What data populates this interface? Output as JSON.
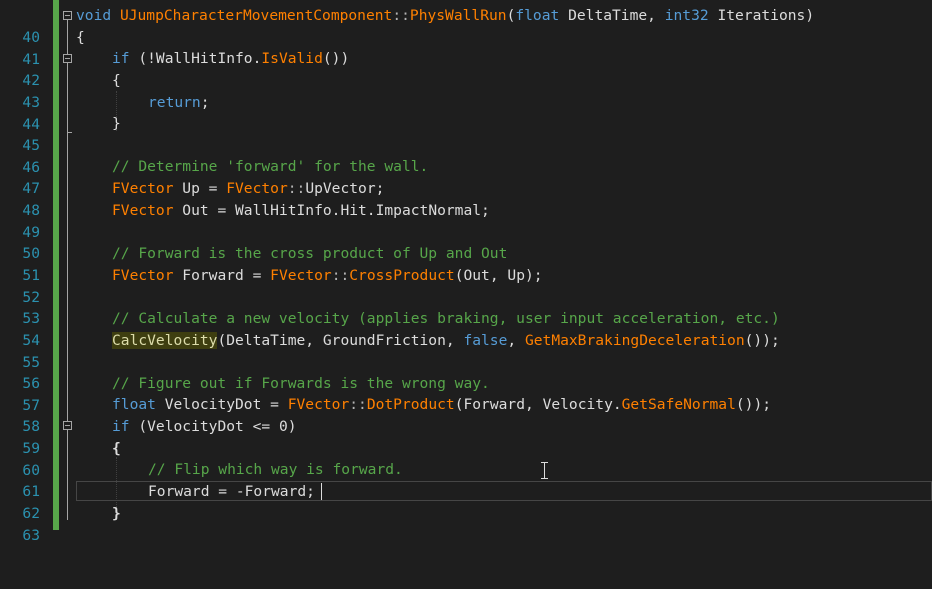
{
  "editor": {
    "colors": {
      "background": "#1e1e1e",
      "line_number": "#2b91af",
      "keyword": "#569cd6",
      "type": "#4ec9b0",
      "function": "#ff8000",
      "comment": "#57a64a",
      "change_bar": "#57a64a"
    },
    "line_numbers": [
      "40",
      "41",
      "42",
      "43",
      "44",
      "45",
      "46",
      "47",
      "48",
      "49",
      "50",
      "51",
      "52",
      "53",
      "54",
      "55",
      "56",
      "57",
      "58",
      "59",
      "60",
      "61",
      "62",
      "63"
    ],
    "tokens": {
      "l40": [
        "void",
        " ",
        "UJumpCharacterMovementComponent",
        "::",
        "PhysWallRun",
        "(",
        "float",
        " DeltaTime, ",
        "int32",
        " Iterations)"
      ],
      "l41": [
        "{"
      ],
      "l42": [
        "if",
        " (!WallHitInfo.",
        "IsValid",
        "())"
      ],
      "l43": [
        "{"
      ],
      "l44": [
        "return",
        ";"
      ],
      "l45": [
        "}"
      ],
      "l47": [
        "// Determine 'forward' for the wall."
      ],
      "l48": [
        "FVector",
        " Up = ",
        "FVector",
        "::",
        "UpVector;"
      ],
      "l49": [
        "FVector",
        " Out = WallHitInfo.Hit.ImpactNormal;"
      ],
      "l51": [
        "// Forward is the cross product of Up and Out"
      ],
      "l52": [
        "FVector",
        " Forward = ",
        "FVector",
        "::",
        "CrossProduct",
        "(Out, Up);"
      ],
      "l54": [
        "// Calculate a new velocity (applies braking, user input acceleration, etc.)"
      ],
      "l55": [
        "CalcVelocity",
        "(DeltaTime, GroundFriction, ",
        "false",
        ", ",
        "GetMaxBrakingDeceleration",
        "());"
      ],
      "l57": [
        "// Figure out if Forwards is the wrong way."
      ],
      "l58": [
        "float",
        " VelocityDot = ",
        "FVector",
        "::",
        "DotProduct",
        "(Forward, Velocity.",
        "GetSafeNormal",
        "());"
      ],
      "l59": [
        "if",
        " (VelocityDot <= 0)"
      ],
      "l60": [
        "{"
      ],
      "l61": [
        "// Flip which way is forward."
      ],
      "l62": [
        "Forward = -Forward;"
      ],
      "l63": [
        "}"
      ]
    }
  }
}
